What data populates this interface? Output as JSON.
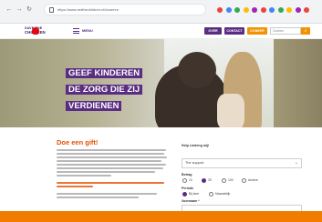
{
  "browser": {
    "back_icon": "arrow-left-icon",
    "forward_icon": "arrow-right-icon",
    "reload_icon": "reload-icon",
    "url": "https://www.redthechildren.nl/doneren",
    "extension_colors": [
      "#e8453c",
      "#4285f4",
      "#34a853",
      "#fbbc05",
      "#9c27b0",
      "#e8453c",
      "#4285f4",
      "#34a853",
      "#fbbc05",
      "#9c27b0",
      "#e8453c"
    ]
  },
  "header": {
    "logo_top": "SAVE THE",
    "logo_bottom": "CHILDREN",
    "menu_label": "MENU",
    "btn_1": "OVER",
    "btn_2": "CONTACT",
    "btn_3": "DONEER",
    "search_placeholder": "Zoeken",
    "colors": {
      "purple": "#5a2d82",
      "orange": "#f39200",
      "red": "#e30613"
    }
  },
  "hero": {
    "title_lines": [
      "GEEF KINDEREN",
      "DE ZORG DIE ZIJ",
      "VERDIENEN"
    ]
  },
  "main": {
    "donate_title": "Doe een gift!"
  },
  "form": {
    "help_label": "Help Lindeng mij!",
    "select_value": "The support",
    "frequency_label": "Betrag",
    "frequency_options": [
      "10",
      "25",
      "100",
      "Andere"
    ],
    "frequency_selected": 1,
    "period_label": "Periode",
    "period_options": [
      "Bij keer",
      "Maandelijk"
    ],
    "period_selected": 0,
    "name_label": "Voornaam *"
  }
}
